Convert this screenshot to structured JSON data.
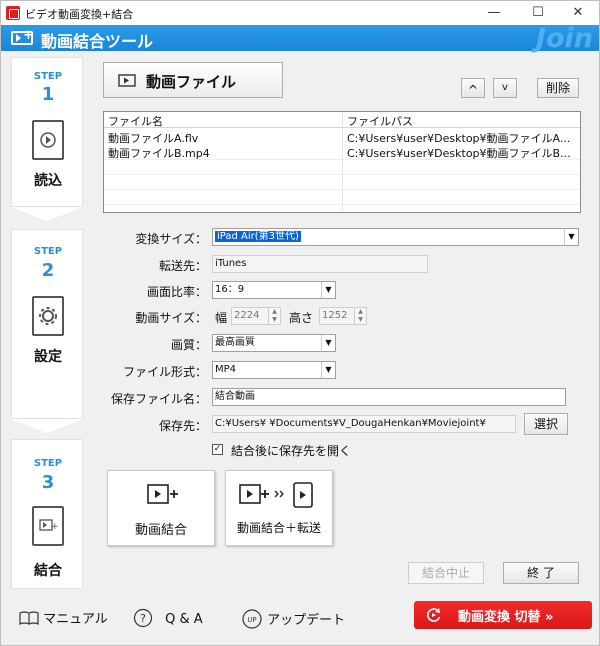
{
  "window": {
    "title": "ビデオ動画変換+結合",
    "controls": {
      "minimize": "—",
      "maximize": "☐",
      "close": "✕"
    }
  },
  "banner": {
    "title": "動画結合ツール",
    "logo": "Join",
    "accent_color": "#1f8ee0"
  },
  "steps": [
    {
      "label": "STEP",
      "number": "1",
      "text": "読込",
      "icon": "play-document-icon"
    },
    {
      "label": "STEP",
      "number": "2",
      "text": "設定",
      "icon": "gear-document-icon"
    },
    {
      "label": "STEP",
      "number": "3",
      "text": "結合",
      "icon": "join-document-icon"
    }
  ],
  "toolbar": {
    "video_file_label": "動画ファイル",
    "up_label": "^",
    "down_label": "v",
    "delete_label": "削除"
  },
  "file_list": {
    "columns": [
      "ファイル名",
      "ファイルパス"
    ],
    "rows": [
      {
        "name": "動画ファイルA.flv",
        "path": "C:¥Users¥user¥Desktop¥動画ファイルA..."
      },
      {
        "name": "動画ファイルB.mp4",
        "path": "C:¥Users¥user¥Desktop¥動画ファイルB..."
      }
    ]
  },
  "settings": {
    "convert_size_label": "変換サイズ：",
    "convert_size_value": "iPad Air(第3世代)",
    "destination_label": "転送先：",
    "destination_value": "iTunes",
    "aspect_label": "画面比率：",
    "aspect_value": "16：9",
    "video_size_label": "動画サイズ：",
    "width_label": "幅",
    "width_value": "2224",
    "height_label": "高さ",
    "height_value": "1252",
    "quality_label": "画質：",
    "quality_value": "最高画質",
    "format_label": "ファイル形式：",
    "format_value": "MP4",
    "save_name_label": "保存ファイル名：",
    "save_name_value": "結合動画",
    "save_dir_label": "保存先：",
    "save_dir_value": "C:¥Users¥        ¥Documents¥V_DougaHenkan¥Moviejoint¥",
    "select_label": "選択",
    "open_after_label": "結合後に保存先を開く",
    "open_after_checked": true
  },
  "actions": {
    "join_label": "動画結合",
    "join_transfer_label": "動画結合＋転送",
    "stop_label": "結合中止",
    "exit_label": "終 了"
  },
  "footer": {
    "manual_label": "マニュアル",
    "qa_label": "Q & A",
    "update_label": "アップデート",
    "switch_label": "動画変換 切替 »",
    "switch_color": "#e81c1c"
  }
}
